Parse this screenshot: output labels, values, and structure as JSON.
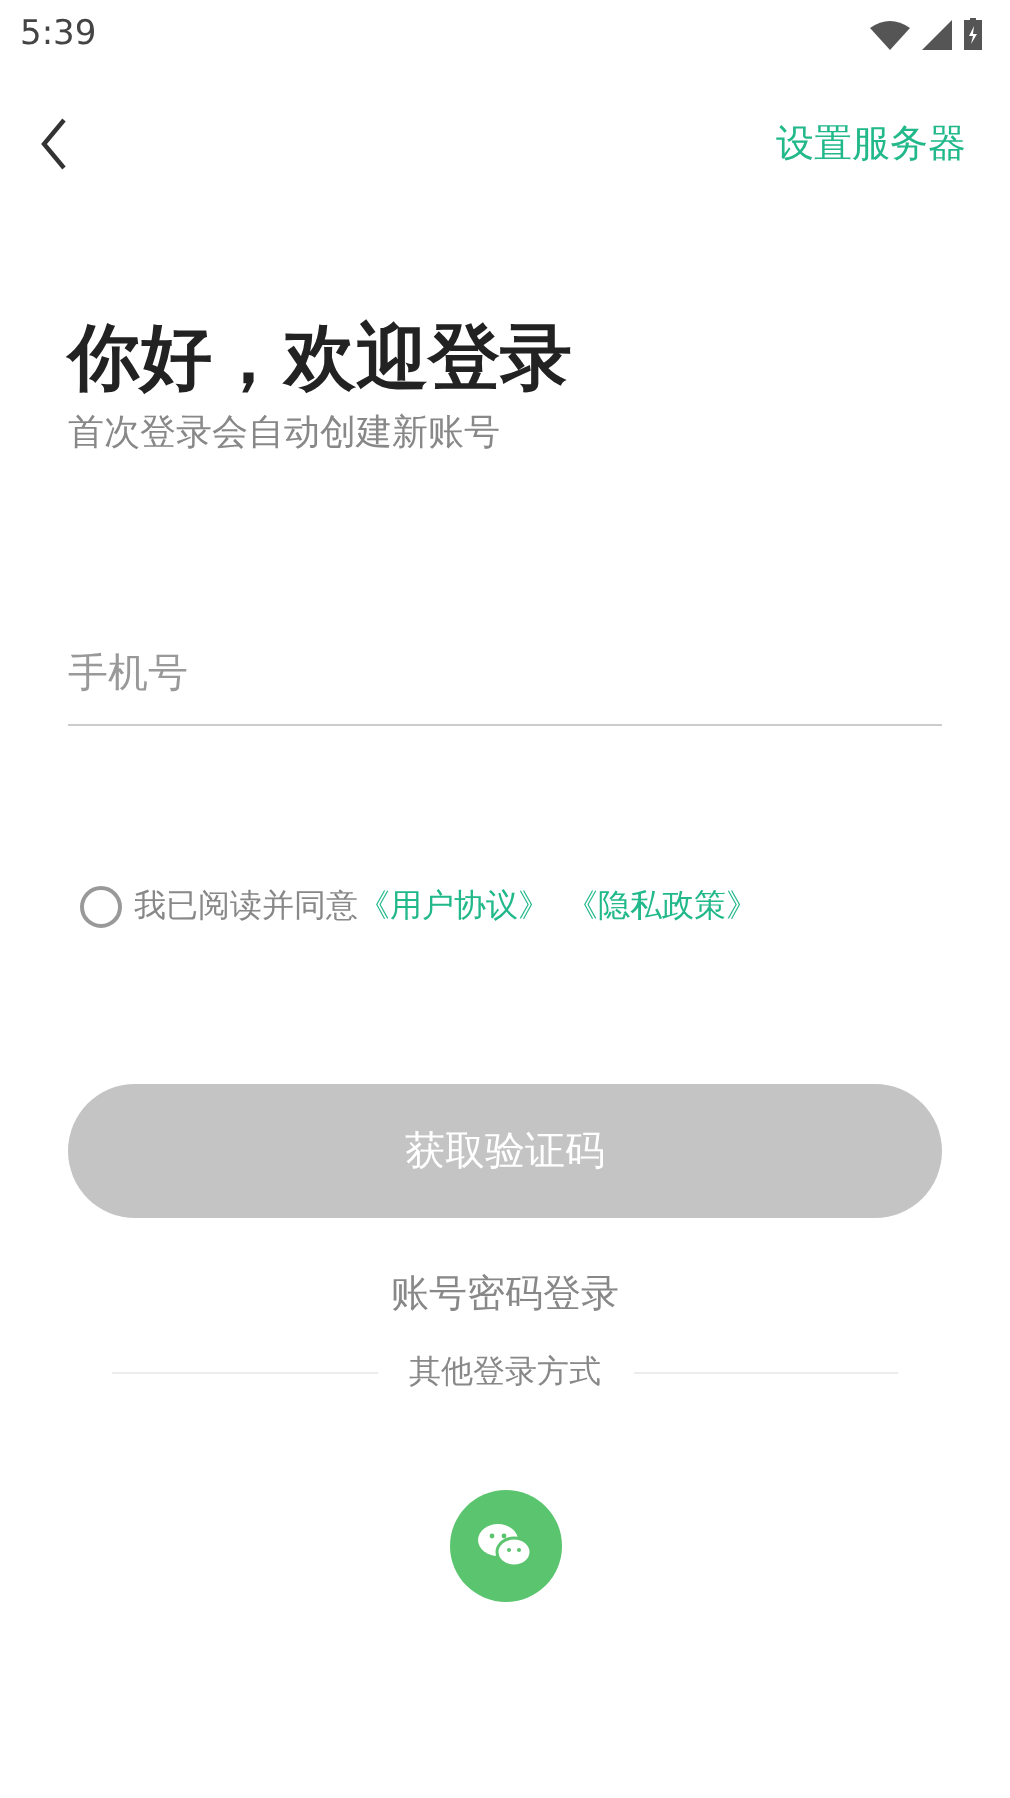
{
  "status_bar": {
    "time": "5:39"
  },
  "header": {
    "action": "设置服务器"
  },
  "title": "你好，欢迎登录",
  "subtitle": "首次登录会自动创建新账号",
  "phone_field": {
    "placeholder": "手机号"
  },
  "agreement": {
    "checked": false,
    "text": "我已阅读并同意",
    "links": [
      "《用户协议》",
      "《隐私政策》"
    ]
  },
  "submit_button": {
    "label": "获取验证码",
    "disabled": true
  },
  "password_login": "账号密码登录",
  "other_methods": "其他登录方式"
}
